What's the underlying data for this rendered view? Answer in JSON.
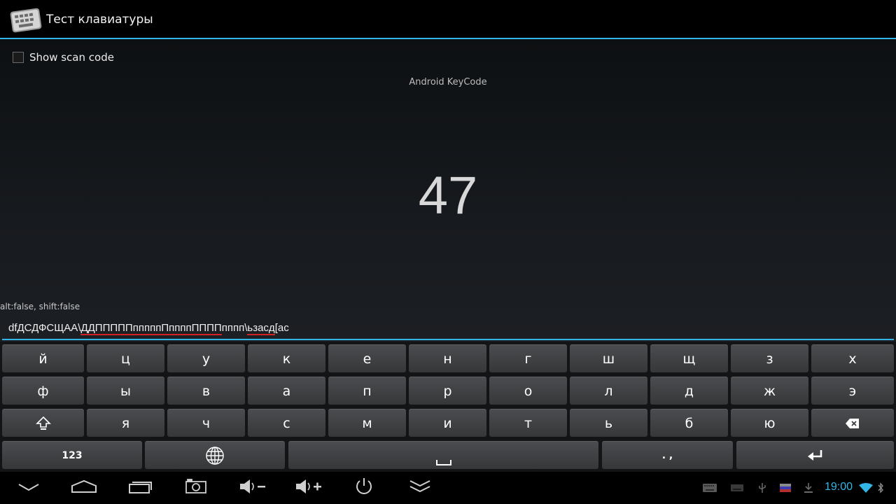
{
  "app": {
    "title": "Тест клавиатуры",
    "icon": "keyboard-icon"
  },
  "content": {
    "show_scan_code_label": "Show scan code",
    "keycode_title": "Android KeyCode",
    "keycode_value": "47",
    "modifiers": "alt:false, shift:false",
    "input": {
      "part1": "dfДСДФСЩАА\\",
      "part2": "ДДПППППпппппПппппПППП",
      "part3": "пппп",
      "part4": "\\",
      "part5": "ьзасд",
      "part6": "[ас"
    }
  },
  "keyboard": {
    "row1": [
      "й",
      "ц",
      "у",
      "к",
      "е",
      "н",
      "г",
      "ш",
      "щ",
      "з",
      "х"
    ],
    "row2": [
      "ф",
      "ы",
      "в",
      "а",
      "п",
      "р",
      "о",
      "л",
      "д",
      "ж",
      "э"
    ],
    "row3": [
      "я",
      "ч",
      "с",
      "м",
      "и",
      "т",
      "ь",
      "б",
      "ю"
    ],
    "row4": {
      "symbols": "123",
      "punct": ". ,"
    }
  },
  "status": {
    "time": "19:00"
  },
  "colors": {
    "accent": "#33b5e5",
    "spell_error": "#d32222"
  }
}
